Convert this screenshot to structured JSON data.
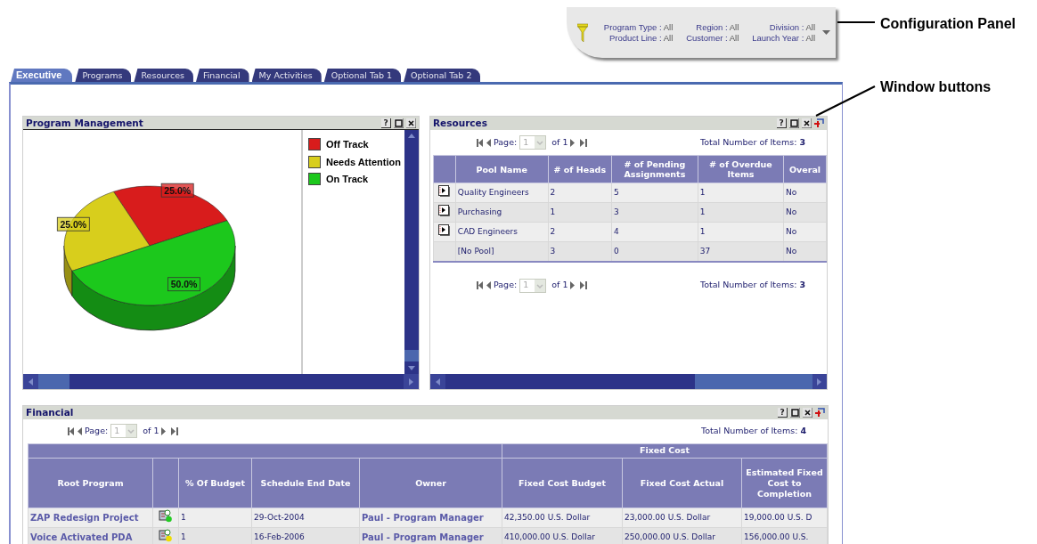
{
  "config_panel": {
    "filters": [
      {
        "label": "Program Type :",
        "value": "All"
      },
      {
        "label": "Region :",
        "value": "All"
      },
      {
        "label": "Division :",
        "value": "All"
      },
      {
        "label": "Product Line :",
        "value": "All"
      },
      {
        "label": "Customer :",
        "value": "All"
      },
      {
        "label": "Launch Year :",
        "value": "All"
      }
    ]
  },
  "annotations": [
    {
      "text": "Configuration Panel"
    },
    {
      "text": "Window buttons"
    }
  ],
  "tabs": [
    {
      "label": "Executive",
      "selected": true
    },
    {
      "label": "Programs",
      "selected": false
    },
    {
      "label": "Resources",
      "selected": false
    },
    {
      "label": "Financial",
      "selected": false
    },
    {
      "label": "My Activities",
      "selected": false
    },
    {
      "label": "Optional Tab 1",
      "selected": false
    },
    {
      "label": "Optional Tab 2",
      "selected": false
    }
  ],
  "program_management": {
    "title": "Program Management",
    "window_buttons": [
      {
        "kind": "help",
        "label": "?"
      },
      {
        "kind": "maximize"
      },
      {
        "kind": "close"
      }
    ],
    "chart_data": {
      "type": "pie",
      "categories": [
        "Off Track",
        "Needs Attention",
        "On Track"
      ],
      "values": [
        25,
        25,
        50
      ],
      "colors": [
        "#d81c1c",
        "#d8ce1c",
        "#1cc81c"
      ],
      "data_labels": true,
      "value_labels": [
        "25.0%",
        "25.0%",
        "50.0%"
      ]
    }
  },
  "resources": {
    "title": "Resources",
    "window_buttons": [
      {
        "kind": "help",
        "label": "?"
      },
      {
        "kind": "maximize"
      },
      {
        "kind": "close"
      },
      {
        "kind": "pin"
      }
    ],
    "pager_top": {
      "page_label": "Page:",
      "page": "1",
      "of": "of 1",
      "total": "Total Number of Items: **3**"
    },
    "table": {
      "columns": [
        {
          "kind": "icon"
        },
        {
          "label": "Pool Name",
          "kind": "text"
        },
        {
          "label": "# of Heads",
          "kind": "text"
        },
        {
          "label": "# of Pending Assignments",
          "kind": "text"
        },
        {
          "label": "# of Overdue Items",
          "kind": "text"
        },
        {
          "label": "Overal",
          "kind": "text"
        }
      ],
      "rows": [
        {
          "has_details": true,
          "cells": [
            "",
            "Quality Engineers",
            "2",
            "5",
            "1",
            "No"
          ]
        },
        {
          "has_details": true,
          "cells": [
            "",
            "Purchasing",
            "1",
            "3",
            "1",
            "No"
          ]
        },
        {
          "has_details": true,
          "cells": [
            "",
            "CAD Engineers",
            "2",
            "4",
            "1",
            "No"
          ]
        },
        {
          "has_details": false,
          "cells": [
            "",
            "[No Pool]",
            "3",
            "0",
            "37",
            "No"
          ]
        }
      ]
    },
    "pager_bottom": {
      "page_label": "Page:",
      "page": "1",
      "of": "of 1",
      "total": "Total Number of Items: **3**"
    }
  },
  "financial": {
    "title": "Financial",
    "window_buttons": [
      {
        "kind": "help",
        "label": "?"
      },
      {
        "kind": "maximize"
      },
      {
        "kind": "close"
      },
      {
        "kind": "pin"
      }
    ],
    "pager": {
      "page_label": "Page:",
      "page": "1",
      "of": "of 1",
      "total": "Total Number of Items: **4**"
    },
    "table": {
      "group_header": "Fixed Cost",
      "columns": [
        {
          "label": "Root Program",
          "kind": "link"
        },
        {
          "kind": "icon"
        },
        {
          "label": "% Of Budget",
          "kind": "text"
        },
        {
          "label": "Schedule End Date",
          "kind": "text"
        },
        {
          "label": "Owner",
          "kind": "link"
        },
        {
          "label": "Fixed Cost Budget",
          "kind": "text"
        },
        {
          "label": "Fixed Cost Actual",
          "kind": "text"
        },
        {
          "label": "Estimated Fixed Cost to Completion",
          "kind": "text"
        }
      ],
      "rows": [
        {
          "color": "#22cc22",
          "cells": [
            "ZAP Redesign Project",
            "",
            "1",
            "29-Oct-2004",
            "Paul - Program Manager",
            "42,350.00 U.S. Dollar",
            "23,000.00 U.S. Dollar",
            "19,000.00 U.S. D"
          ]
        },
        {
          "color": "#eedd00",
          "cells": [
            "Voice Activated PDA",
            "",
            "1",
            "16-Feb-2006",
            "Paul - Program Manager",
            "410,000.00 U.S. Dollar",
            "250,000.00 U.S. Dollar",
            "156,000.00 U.S."
          ]
        }
      ]
    }
  }
}
